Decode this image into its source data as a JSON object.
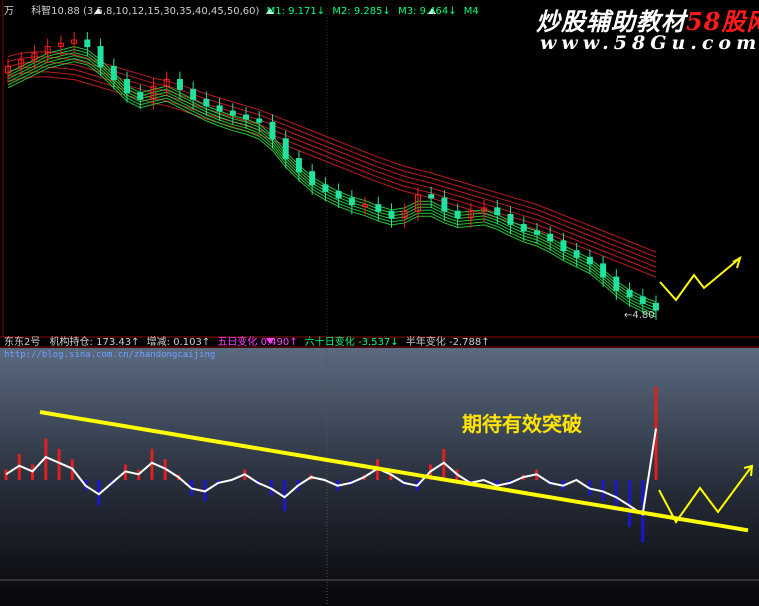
{
  "upper_header": {
    "symbol": "万",
    "indicator": "科智10.88",
    "ma_params": "(3,5,8,10,12,15,30,35,40,45,50,60)",
    "m1": "M1: 9.171↓",
    "m2": "M2: 9.285↓",
    "m3": "M3: 9.464↓",
    "m4": "M4"
  },
  "lower_header": {
    "name": "东东2号",
    "holding": "机构持仓: 173.43↑",
    "change": "增减: 0.103↑",
    "d5": "五日变化 0.490↑",
    "d60": "六十日变化 -3.537↓",
    "half": "半年变化 -2.788↑"
  },
  "watermark": {
    "site": "炒股辅助教材",
    "brand": "58股网",
    "url": "www.58Gu.com"
  },
  "blog_url": "http://blog.sina.com.cn/zhandongcaijing",
  "low_label": "←4.80",
  "annotation": "期待有效突破",
  "colors": {
    "up": "#ff2020",
    "down": "#2b7bff",
    "ma_short": "#2cd63a",
    "ma_long": "#d02020",
    "trend": "#ffff00",
    "line": "#ffffff",
    "bar_up": "#e02020",
    "bar_down": "#1818d0"
  },
  "chart_data": [
    {
      "type": "candlestick",
      "title": "",
      "series": [
        {
          "name": "close",
          "values": [
            10.4,
            10.5,
            10.6,
            10.7,
            10.75,
            10.8,
            10.7,
            10.4,
            10.2,
            10.0,
            9.9,
            10.1,
            10.2,
            10.05,
            9.9,
            9.8,
            9.72,
            9.66,
            9.6,
            9.55,
            9.3,
            9.0,
            8.8,
            8.6,
            8.5,
            8.4,
            8.3,
            8.3,
            8.2,
            8.1,
            8.2,
            8.45,
            8.4,
            8.2,
            8.1,
            8.2,
            8.25,
            8.15,
            8.0,
            7.9,
            7.85,
            7.75,
            7.6,
            7.5,
            7.4,
            7.2,
            7.0,
            6.9,
            6.8,
            6.7
          ]
        },
        {
          "name": "ma_short",
          "values": [
            10.3,
            10.4,
            10.5,
            10.6,
            10.65,
            10.7,
            10.65,
            10.5,
            10.3,
            10.1,
            10.0,
            10.05,
            10.1,
            10.0,
            9.9,
            9.8,
            9.72,
            9.65,
            9.6,
            9.52,
            9.35,
            9.1,
            8.9,
            8.72,
            8.6,
            8.5,
            8.42,
            8.36,
            8.28,
            8.22,
            8.25,
            8.35,
            8.35,
            8.25,
            8.18,
            8.2,
            8.22,
            8.15,
            8.05,
            7.96,
            7.9,
            7.8,
            7.68,
            7.58,
            7.48,
            7.32,
            7.14,
            7.0,
            6.9,
            6.82
          ]
        },
        {
          "name": "ma_long",
          "values": [
            10.55,
            10.6,
            10.62,
            10.62,
            10.6,
            10.58,
            10.52,
            10.46,
            10.4,
            10.34,
            10.28,
            10.22,
            10.18,
            10.12,
            10.05,
            9.98,
            9.92,
            9.86,
            9.8,
            9.74,
            9.66,
            9.58,
            9.5,
            9.42,
            9.34,
            9.26,
            9.18,
            9.1,
            9.02,
            8.95,
            8.88,
            8.83,
            8.78,
            8.72,
            8.66,
            8.6,
            8.54,
            8.48,
            8.42,
            8.36,
            8.3,
            8.22,
            8.14,
            8.06,
            7.98,
            7.9,
            7.82,
            7.74,
            7.66,
            7.58
          ]
        }
      ],
      "annotations": [
        "4.80"
      ]
    },
    {
      "type": "bar",
      "title": "",
      "series": [
        {
          "name": "institutional_holding",
          "values": [
            2,
            5,
            3,
            8,
            6,
            4,
            -2,
            -5,
            -1,
            3,
            2,
            6,
            4,
            1,
            -3,
            -4,
            -1,
            0,
            2,
            -1,
            -3,
            -6,
            -2,
            1,
            0,
            -2,
            -1,
            1,
            4,
            2,
            -1,
            -2,
            3,
            6,
            2,
            -1,
            0,
            -2,
            -1,
            1,
            2,
            -1,
            -2,
            0,
            -3,
            -4,
            -6,
            -9,
            -12,
            18
          ]
        },
        {
          "name": "trend_line",
          "values": [
            10,
            9.4,
            8.8,
            8.2,
            7.6,
            7.0,
            6.4,
            5.8,
            5.2,
            4.6,
            4.0,
            3.4,
            2.8,
            2.2,
            1.6,
            1.0,
            0.4,
            -0.2,
            -0.8,
            -1.4,
            -2.0,
            -2.6,
            -3.2,
            -3.8,
            -4.4,
            -5.0,
            -5.6,
            -6.2,
            -6.8,
            -7.4
          ]
        }
      ]
    }
  ]
}
